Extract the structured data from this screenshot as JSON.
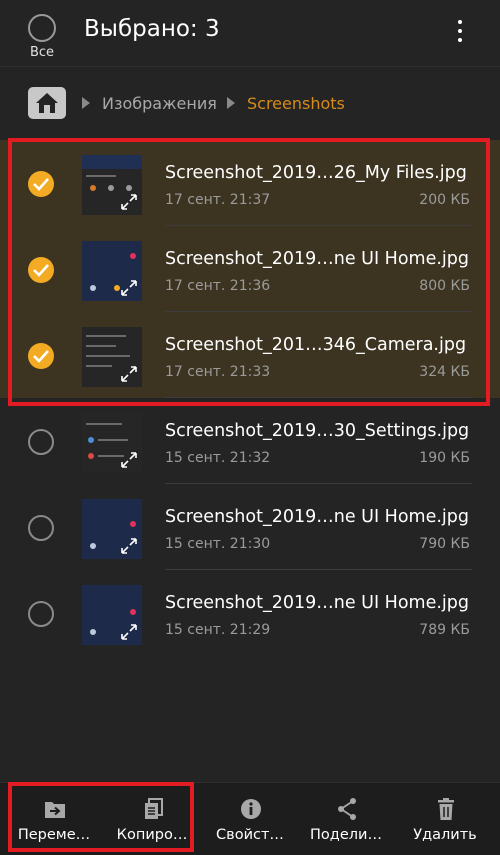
{
  "header": {
    "select_all_label": "Все",
    "title": "Выбрано: 3"
  },
  "breadcrumb": {
    "items": [
      "Изображения",
      "Screenshots"
    ]
  },
  "files": [
    {
      "name": "Screenshot_2019…26_My Files.jpg",
      "date": "17 сент. 21:37",
      "size": "200 КБ",
      "selected": true
    },
    {
      "name": "Screenshot_2019…ne UI Home.jpg",
      "date": "17 сент. 21:36",
      "size": "800 КБ",
      "selected": true
    },
    {
      "name": "Screenshot_201…346_Camera.jpg",
      "date": "17 сент. 21:33",
      "size": "324 КБ",
      "selected": true
    },
    {
      "name": "Screenshot_2019…30_Settings.jpg",
      "date": "15 сент. 21:32",
      "size": "190 КБ",
      "selected": false
    },
    {
      "name": "Screenshot_2019…ne UI Home.jpg",
      "date": "15 сент. 21:30",
      "size": "790 КБ",
      "selected": false
    },
    {
      "name": "Screenshot_2019…ne UI Home.jpg",
      "date": "15 сент. 21:29",
      "size": "789 КБ",
      "selected": false
    }
  ],
  "actions": [
    {
      "label": "Переме…",
      "icon": "move-icon"
    },
    {
      "label": "Копиро…",
      "icon": "copy-icon"
    },
    {
      "label": "Свойст…",
      "icon": "info-icon"
    },
    {
      "label": "Подели…",
      "icon": "share-icon"
    },
    {
      "label": "Удалить",
      "icon": "delete-icon"
    }
  ],
  "colors": {
    "accent": "#f3ab23",
    "breadcrumb_active": "#d78b1a",
    "selected_row": "#3d3321",
    "highlight_box": "#e31b23"
  }
}
